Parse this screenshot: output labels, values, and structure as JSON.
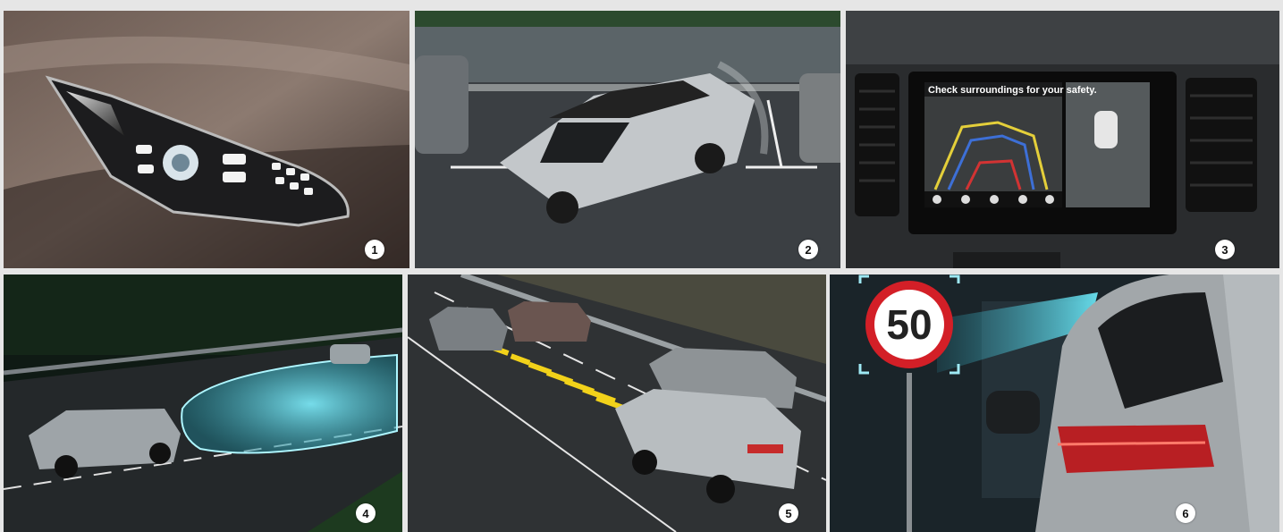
{
  "panels": [
    {
      "number": "1",
      "icon": "led-headlamp-icon"
    },
    {
      "number": "2",
      "icon": "parking-assist-icon"
    },
    {
      "number": "3",
      "icon": "camera-monitor-icon"
    },
    {
      "number": "4",
      "icon": "high-beam-assist-icon"
    },
    {
      "number": "5",
      "icon": "blind-spot-icon"
    },
    {
      "number": "6",
      "icon": "speed-sign-recognition-icon"
    }
  ],
  "screen": {
    "warning_text": "Check surroundings for your safety."
  },
  "speed_sign": {
    "value": "50"
  },
  "colors": {
    "frame": "#d9d9d9",
    "camera_glow": "#4fd3e6",
    "taillight": "#d42025",
    "crosswalk": "#f2d21a"
  }
}
